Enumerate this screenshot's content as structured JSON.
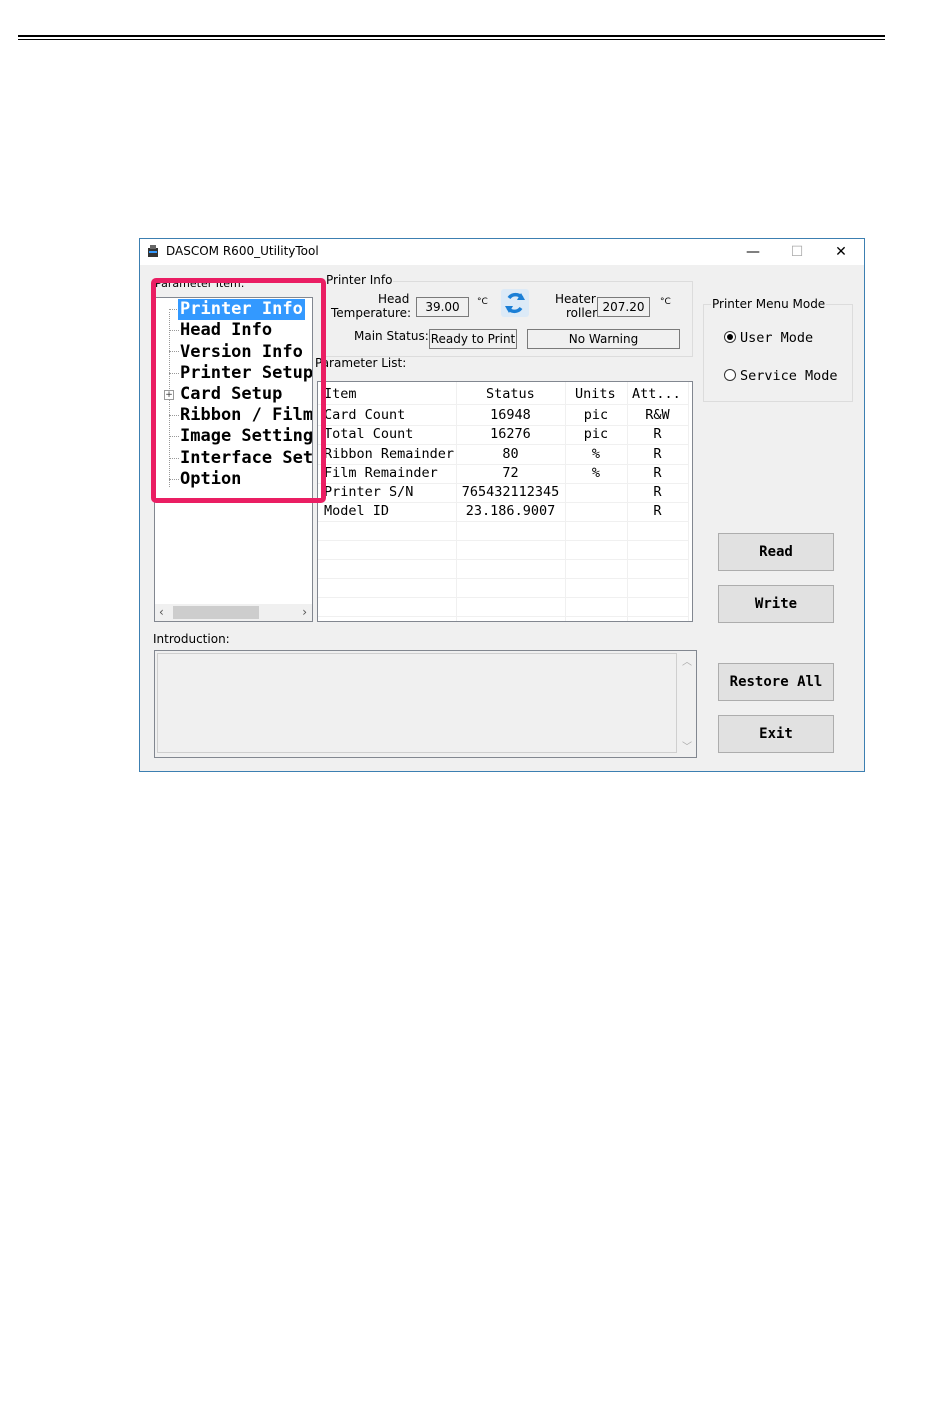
{
  "window": {
    "title": "DASCOM R600_UtilityTool",
    "minimize_glyph": "—",
    "maximize_glyph": "☐",
    "close_glyph": "✕"
  },
  "parameter_item": {
    "caption": "Parameter Item:",
    "items": [
      "Printer Info",
      "Head Info",
      "Version Info",
      "Printer Setup",
      "Card Setup",
      "Ribbon / Film",
      "Image Setting",
      "Interface Set",
      "Option"
    ],
    "selected": "Printer Info",
    "expandable": "Card Setup"
  },
  "printer_info": {
    "caption": "Printer Info",
    "head_temp_label_1": "Head",
    "head_temp_label_2": "Temperature:",
    "head_temp_value": "39.00",
    "head_temp_unit": "°C",
    "heater_label_1": "Heater",
    "heater_label_2": "roller",
    "heater_value": "207.20",
    "heater_unit": "°C",
    "main_status_label": "Main Status:",
    "main_status_value": "Ready to Print",
    "warning_value": "No Warning"
  },
  "parameter_list": {
    "caption": "Parameter List:",
    "columns": [
      "Item",
      "Status",
      "Units",
      "Att..."
    ],
    "rows": [
      {
        "item": "Card Count",
        "status": "16948",
        "units": "pic",
        "att": "R&W"
      },
      {
        "item": "Total Count",
        "status": "16276",
        "units": "pic",
        "att": "R"
      },
      {
        "item": "Ribbon Remainder",
        "status": "80",
        "units": "%",
        "att": "R"
      },
      {
        "item": "Film Remainder",
        "status": "72",
        "units": "%",
        "att": "R"
      },
      {
        "item": "Printer S/N",
        "status": "765432112345",
        "units": "",
        "att": "R"
      },
      {
        "item": "Model ID",
        "status": "23.186.9007",
        "units": "",
        "att": "R"
      }
    ]
  },
  "menu_mode": {
    "caption": "Printer Menu Mode",
    "user_mode": "User Mode",
    "service_mode": "Service Mode",
    "selected": "User Mode"
  },
  "buttons": {
    "read": "Read",
    "write": "Write",
    "restore_all": "Restore All",
    "exit": "Exit"
  },
  "introduction": {
    "caption": "Introduction:",
    "text": ""
  },
  "colors": {
    "highlight_box": "#ea1e63",
    "selection": "#3399ff",
    "window_border": "#3c7fb1"
  }
}
